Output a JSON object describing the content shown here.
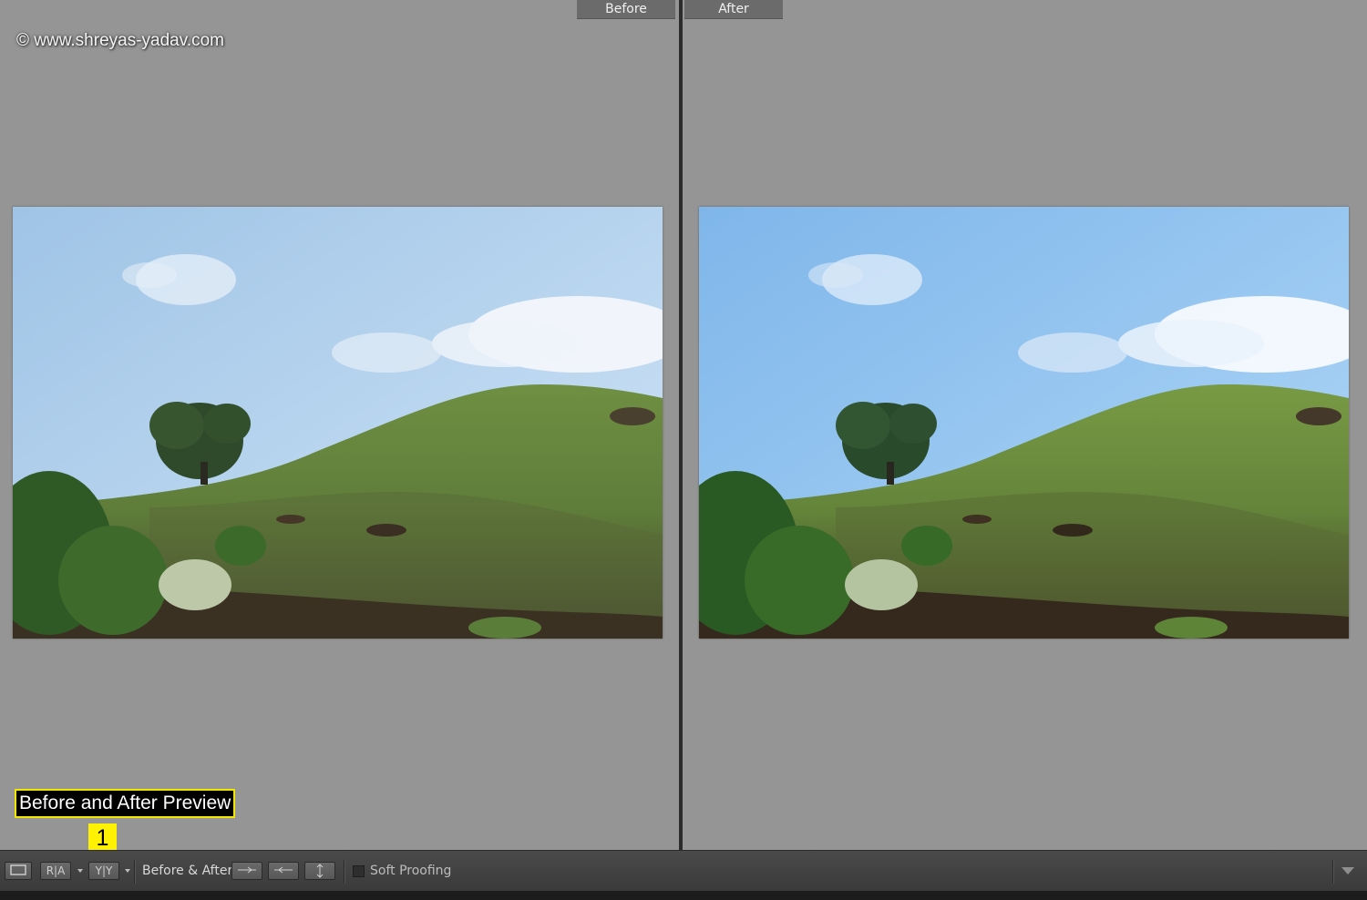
{
  "watermark": "© www.shreyas-yadav.com",
  "panes": {
    "before_label": "Before",
    "after_label": "After"
  },
  "annotation": {
    "caption": "Before and After Preview",
    "callout_number": "1"
  },
  "toolbar": {
    "loupe_view": "loupe-view-icon",
    "ra_split": "R|A",
    "yy_split": "Y|Y",
    "before_after_label": "Before & After :",
    "copy_before_to_after": "arrow-right-icon",
    "copy_after_to_before": "arrow-left-icon",
    "swap": "swap-vertical-icon",
    "soft_proofing_label": "Soft Proofing",
    "soft_proofing_checked": false,
    "menu": "chevron-down-icon"
  },
  "colors": {
    "annotation_yellow": "#fff200",
    "background_gray": "#959595",
    "toolbar": "#444444"
  }
}
